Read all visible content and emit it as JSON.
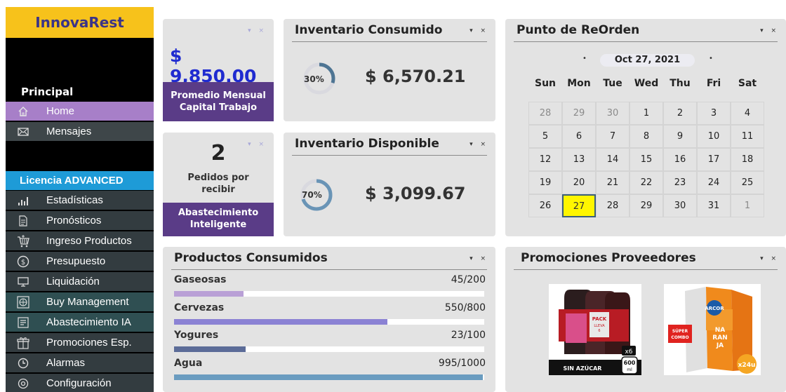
{
  "sidebar": {
    "brand": "InnovaRest",
    "principal_title": "Principal",
    "principal_items": [
      {
        "label": "Home",
        "icon": "home-icon"
      },
      {
        "label": "Mensajes",
        "icon": "mail-icon"
      }
    ],
    "license_title": "Licencia ADVANCED",
    "license_items": [
      {
        "label": "Estadísticas",
        "icon": "bar-chart-icon"
      },
      {
        "label": "Pronósticos",
        "icon": "document-icon"
      },
      {
        "label": "Ingreso Productos",
        "icon": "cart-icon"
      },
      {
        "label": "Presupuesto",
        "icon": "dollar-icon"
      },
      {
        "label": "Liquidación",
        "icon": "monitor-icon"
      },
      {
        "label": "Buy Management",
        "icon": "basketball-icon"
      },
      {
        "label": "Abastecimiento IA",
        "icon": "list-icon"
      },
      {
        "label": "Promociones Esp.",
        "icon": "gift-icon"
      },
      {
        "label": "Alarmas",
        "icon": "clock-icon"
      },
      {
        "label": "Configuración",
        "icon": "settings-icon"
      }
    ]
  },
  "capital": {
    "value": "$ 9,850.00",
    "band_line1": "Promedio Mensual",
    "band_line2": "Capital Trabajo"
  },
  "pedidos": {
    "value": "2",
    "line1": "Pedidos por",
    "line2": "recibir",
    "band_line1": "Abastecimiento",
    "band_line2": "Inteligente"
  },
  "consumido": {
    "title": "Inventario Consumido",
    "percent_label": "30%",
    "percent": 0.3,
    "amount": "$ 6,570.21"
  },
  "disponible": {
    "title": "Inventario Disponible",
    "percent_label": "70%",
    "percent": 0.7,
    "amount": "$ 3,099.67"
  },
  "calendar": {
    "title": "Punto de ReOrden",
    "month_label": "Oct 27, 2021",
    "days_of_week": [
      "Sun",
      "Mon",
      "Tue",
      "Wed",
      "Thu",
      "Fri",
      "Sat"
    ],
    "weeks": [
      [
        "28",
        "29",
        "30",
        "1",
        "2",
        "3",
        "4"
      ],
      [
        "5",
        "6",
        "7",
        "8",
        "9",
        "10",
        "11"
      ],
      [
        "12",
        "13",
        "14",
        "15",
        "16",
        "17",
        "18"
      ],
      [
        "19",
        "20",
        "21",
        "22",
        "23",
        "24",
        "25"
      ],
      [
        "26",
        "27",
        "28",
        "29",
        "30",
        "31",
        "1"
      ]
    ],
    "selected": "27"
  },
  "productos": {
    "title": "Productos Consumidos",
    "items": [
      {
        "name": "Gaseosas",
        "value": "45/200",
        "fraction": 0.225,
        "color": "#b9a0d6"
      },
      {
        "name": "Cervezas",
        "value": "550/800",
        "fraction": 0.6875,
        "color": "#8b82d4"
      },
      {
        "name": "Yogures",
        "value": "23/100",
        "fraction": 0.23,
        "color": "#5c6c98"
      },
      {
        "name": "Agua",
        "value": "995/1000",
        "fraction": 0.995,
        "color": "#6a9cc0"
      }
    ]
  },
  "promos": {
    "title": "Promociones Proveedores",
    "item1": {
      "pack": "PACK",
      "promo_line1": "LLEVA",
      "promo_line2": "6",
      "multiplier": "x6",
      "size_top": "600",
      "size_unit": "ml",
      "caption": "SIN AZÚCAR"
    },
    "item2": {
      "brand": "ARCOR",
      "combo_line1": "SÚPER",
      "combo_line2": "COMBO",
      "product_line1": "NA",
      "product_line2": "RAN",
      "product_line3": "JA",
      "count": "x24u"
    }
  }
}
